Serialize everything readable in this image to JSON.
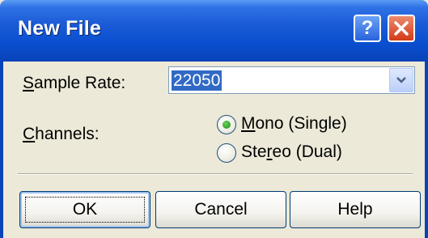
{
  "window": {
    "title": "New File",
    "help_glyph": "?",
    "close_glyph": "×"
  },
  "sample_rate": {
    "label_access": "S",
    "label_rest": "ample Rate:",
    "value": "22050"
  },
  "channels": {
    "label_access": "C",
    "label_rest": "hannels:",
    "options": [
      {
        "label_pre": "",
        "access": "M",
        "label_post": "ono (Single)",
        "selected": true
      },
      {
        "label_pre": "Ste",
        "access": "r",
        "label_post": "eo (Dual)",
        "selected": false
      }
    ]
  },
  "buttons": {
    "ok": "OK",
    "cancel": "Cancel",
    "help": "Help"
  },
  "colors": {
    "titlebar": "#0a4fd0",
    "selection": "#316ac5",
    "dialog_bg": "#ece9d8"
  },
  "icons": {
    "help": "help-icon",
    "close": "close-icon",
    "dropdown": "chevron-down-icon"
  }
}
